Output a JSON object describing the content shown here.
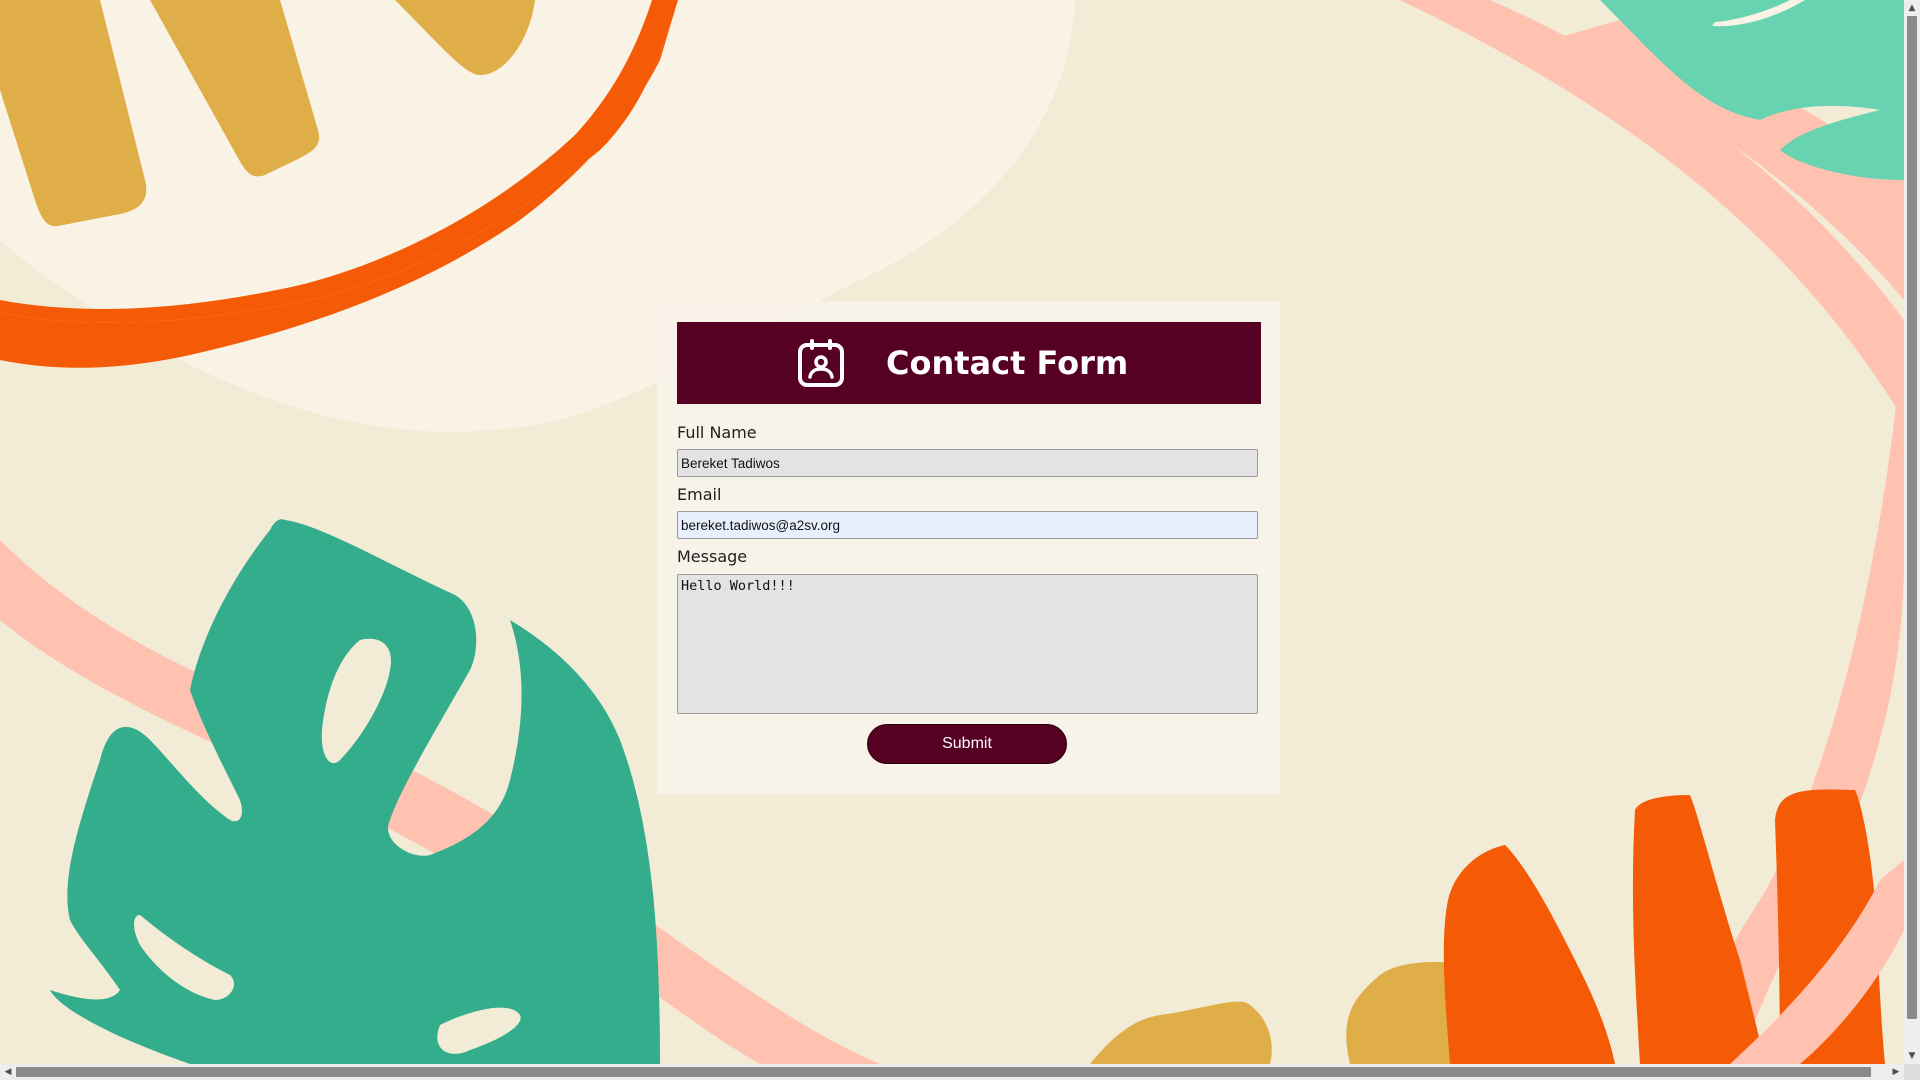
{
  "form": {
    "title": "Contact Form",
    "header_icon": "contact-calendar-icon",
    "fields": {
      "full_name": {
        "label": "Full Name",
        "value": "Bereket Tadiwos"
      },
      "email": {
        "label": "Email",
        "value": "bereket.tadiwos@a2sv.org"
      },
      "message": {
        "label": "Message",
        "value": "Hello World!!!"
      }
    },
    "submit_label": "Submit"
  },
  "colors": {
    "header_bg": "#560024",
    "button_bg": "#560024",
    "page_bg": "#f2ebd6",
    "accent_orange": "#f55a06",
    "accent_green": "#34ad8d",
    "accent_pink": "#ffc1b0",
    "accent_mustard": "#e0ae48",
    "accent_mint": "#68d3b0"
  },
  "scrollbars": {
    "up_icon": "arrow-up-icon",
    "down_icon": "arrow-down-icon",
    "left_icon": "arrow-left-icon",
    "right_icon": "arrow-right-icon"
  }
}
